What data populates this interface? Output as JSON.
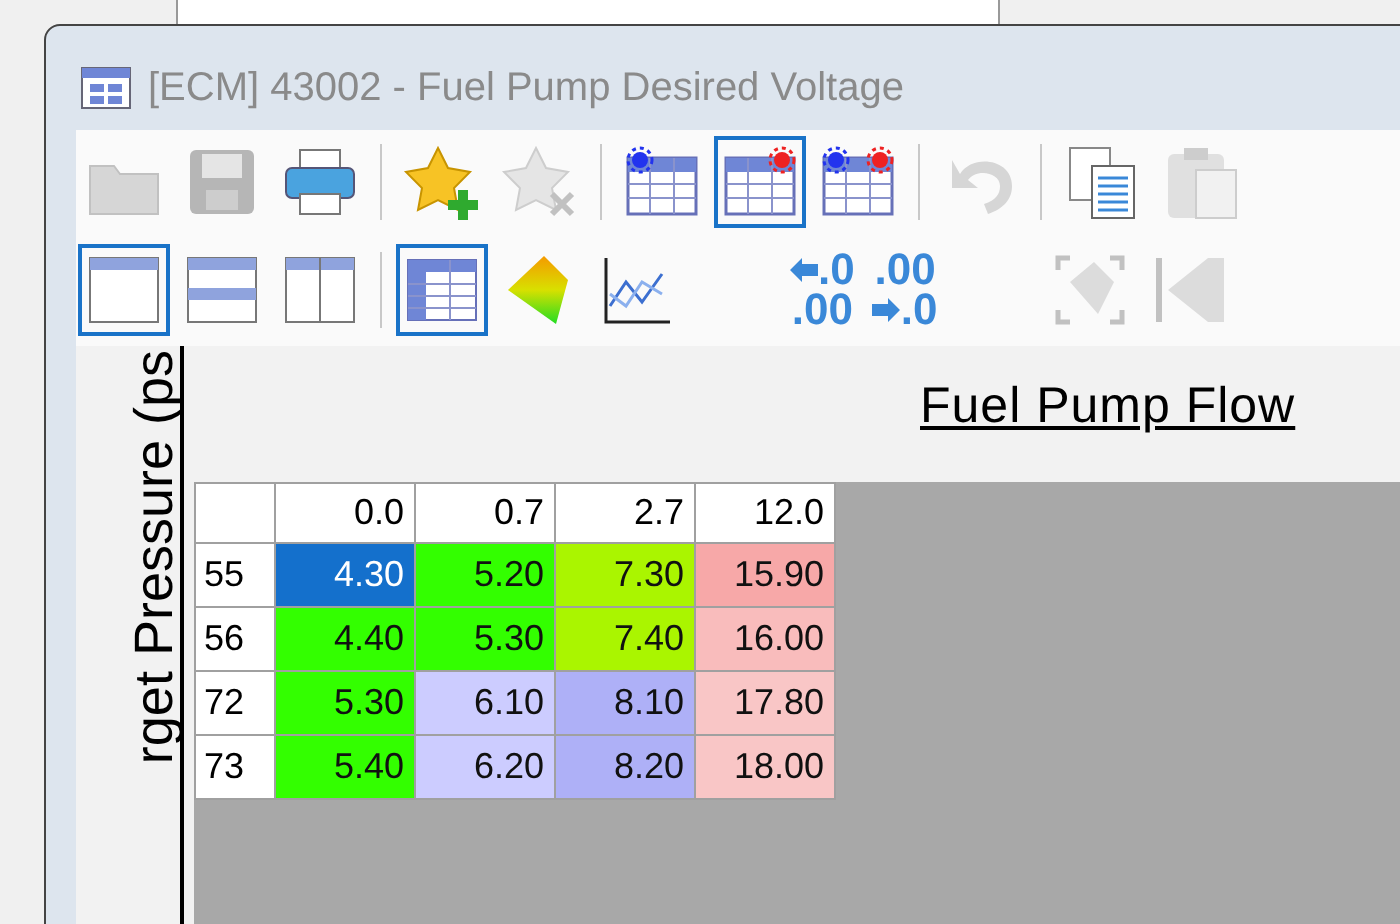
{
  "window": {
    "title": "[ECM] 43002 - Fuel Pump Desired Voltage"
  },
  "toolbar_1": [
    {
      "kind": "open",
      "disabled": true,
      "selected": false
    },
    {
      "kind": "save",
      "disabled": true,
      "selected": false
    },
    {
      "kind": "print",
      "disabled": false,
      "selected": false
    },
    {
      "kind": "separator"
    },
    {
      "kind": "favorite-add",
      "disabled": false,
      "selected": false
    },
    {
      "kind": "favorite-remove",
      "disabled": true,
      "selected": false
    },
    {
      "kind": "separator"
    },
    {
      "kind": "table-left-gear",
      "disabled": false,
      "selected": false
    },
    {
      "kind": "table-right-gear",
      "disabled": false,
      "selected": true
    },
    {
      "kind": "table-both-gear",
      "disabled": false,
      "selected": false
    },
    {
      "kind": "separator"
    },
    {
      "kind": "undo",
      "disabled": true,
      "selected": false
    },
    {
      "kind": "separator"
    },
    {
      "kind": "copy",
      "disabled": false,
      "selected": false
    },
    {
      "kind": "paste",
      "disabled": true,
      "selected": false
    }
  ],
  "toolbar_2": [
    {
      "kind": "layout-single",
      "disabled": false,
      "selected": true
    },
    {
      "kind": "layout-rows",
      "disabled": false,
      "selected": false
    },
    {
      "kind": "layout-columns",
      "disabled": false,
      "selected": false
    },
    {
      "kind": "separator"
    },
    {
      "kind": "table-view",
      "disabled": false,
      "selected": true
    },
    {
      "kind": "surface-3d",
      "disabled": false,
      "selected": false
    },
    {
      "kind": "line-graph",
      "disabled": false,
      "selected": false
    },
    {
      "kind": "spacer"
    },
    {
      "kind": "decimal-less",
      "top": ".0",
      "bottom": ".00",
      "disabled": false,
      "selected": false
    },
    {
      "kind": "decimal-more",
      "top": ".00",
      "bottom": ".0",
      "disabled": false,
      "selected": false
    },
    {
      "kind": "spacer"
    },
    {
      "kind": "focus-shape",
      "disabled": true,
      "selected": false
    },
    {
      "kind": "first-shape",
      "disabled": true,
      "selected": false
    }
  ],
  "y_axis_label": "rget Pressure (ps",
  "x_axis_label": "Fuel Pump Flow",
  "table": {
    "columns": [
      "0.0",
      "0.7",
      "2.7",
      "12.0"
    ],
    "rows": [
      {
        "label": "55",
        "cells": [
          {
            "value": "4.30",
            "selected": true
          },
          {
            "value": "5.20",
            "color": "#33ff00",
            "selected": false
          },
          {
            "value": "7.30",
            "color": "#aaf500",
            "selected": false
          },
          {
            "value": "15.90",
            "color": "#f7a8a8",
            "selected": false
          }
        ]
      },
      {
        "label": "56",
        "cells": [
          {
            "value": "4.40",
            "color": "#33ff00",
            "selected": false
          },
          {
            "value": "5.30",
            "color": "#33ff00",
            "selected": false
          },
          {
            "value": "7.40",
            "color": "#aaf500",
            "selected": false
          },
          {
            "value": "16.00",
            "color": "#f9bcbc",
            "selected": false
          }
        ]
      },
      {
        "label": "72",
        "cells": [
          {
            "value": "5.30",
            "color": "#33ff00",
            "selected": false
          },
          {
            "value": "6.10",
            "color": "#ccccff",
            "selected": false
          },
          {
            "value": "8.10",
            "color": "#aeb0f7",
            "selected": false
          },
          {
            "value": "17.80",
            "color": "#f9c6c6",
            "selected": false
          }
        ]
      },
      {
        "label": "73",
        "cells": [
          {
            "value": "5.40",
            "color": "#33ff00",
            "selected": false
          },
          {
            "value": "6.20",
            "color": "#ccccff",
            "selected": false
          },
          {
            "value": "8.20",
            "color": "#aeb0f7",
            "selected": false
          },
          {
            "value": "18.00",
            "color": "#f9c6c6",
            "selected": false
          }
        ]
      }
    ]
  }
}
